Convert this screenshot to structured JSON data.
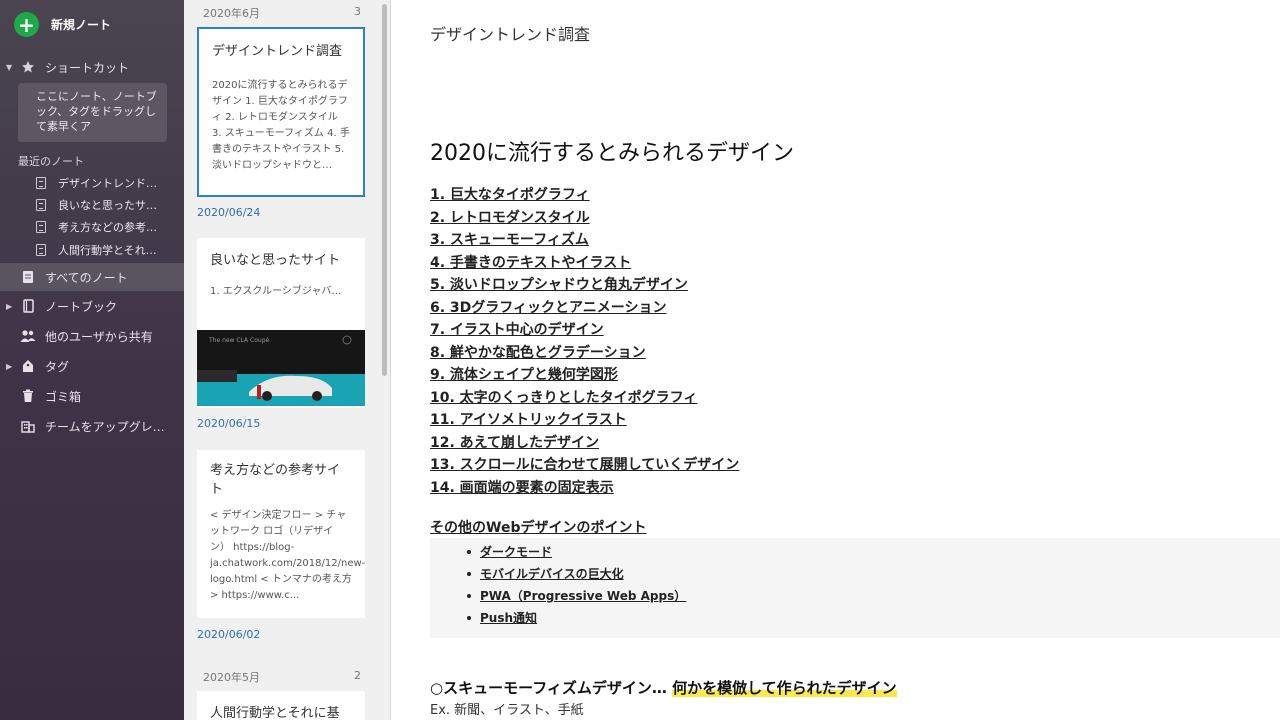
{
  "sidebar": {
    "new_note": "新規ノート",
    "shortcut_label": "ショートカット",
    "shortcut_hint": "ここにノート、ノートブック、タグをドラッグして素早くア",
    "recent_label": "最近のノート",
    "recent_notes": [
      "デザイントレンド…",
      "良いなと思ったサ…",
      "考え方などの参考…",
      "人間行動学とそれ…"
    ],
    "all_notes": "すべてのノート",
    "notebook": "ノートブック",
    "shared": "他のユーザから共有",
    "tags": "タグ",
    "trash": "ゴミ箱",
    "upgrade": "チームをアップグレ…"
  },
  "note_list": {
    "group1": {
      "month": "2020年6月",
      "count": "3"
    },
    "group2": {
      "month": "2020年5月",
      "count": "2"
    },
    "cards": [
      {
        "title": "デザイントレンド調査",
        "snippet": "2020に流行するとみられるデザイン 1. 巨大なタイポグラフィ 2. レトロモダンスタイル 3. スキューモーフィズム 4. 手書きのテキストやイラスト 5. 淡いドロップシャドウと…",
        "date": "2020/06/24"
      },
      {
        "title": "良いなと思ったサイト",
        "snippet": "1. エクスクルーシブジャバ…",
        "thumb_text": "The new CLA Coupé",
        "date": "2020/06/15"
      },
      {
        "title": "考え方などの参考サイト",
        "snippet": "< デザイン決定フロー > チャットワーク ロゴ（リデザイン） https://blog-ja.chatwork.com/2018/12/new-logo.html < トンマナの考え方 > https://www.c...",
        "date": "2020/06/02"
      },
      {
        "title": "人間行動学とそれに基"
      }
    ]
  },
  "editor": {
    "title": "デザイントレンド調査",
    "heading": "2020に流行するとみられるデザイン",
    "trends": [
      "1. 巨大なタイポグラフィ",
      "2. レトロモダンスタイル",
      "3. スキューモーフィズム",
      "4. 手書きのテキストやイラスト",
      "5. 淡いドロップシャドウと角丸デザイン",
      "6. 3Dグラフィックとアニメーション",
      "7. イラスト中心のデザイン",
      "8. 鮮やかな配色とグラデーション",
      "9. 流体シェイプと幾何学図形",
      "10. 太字のくっきりとしたタイポグラフィ",
      "11. アイソメトリックイラスト",
      "12. あえて崩したデザイン",
      "13. スクロールに合わせて展開していくデザイン",
      "14. 画面端の要素の固定表示"
    ],
    "others_head": "その他のWebデザインのポイント",
    "others": [
      "ダークモード",
      "モバイルデバイスの巨大化",
      "PWA（Progressive Web Apps）",
      "Push通知"
    ],
    "sk_head": "○スキューモーフィズムデザイン…",
    "sk_highlight": "何かを模倣して作られたデザイン",
    "ex": "Ex.  新聞、イラスト、手紙"
  },
  "colors": {
    "accent": "#1fa84a",
    "selected_border": "#2e7fd0",
    "date_blue": "#2e6fb3",
    "highlight": "#fbe94a"
  }
}
